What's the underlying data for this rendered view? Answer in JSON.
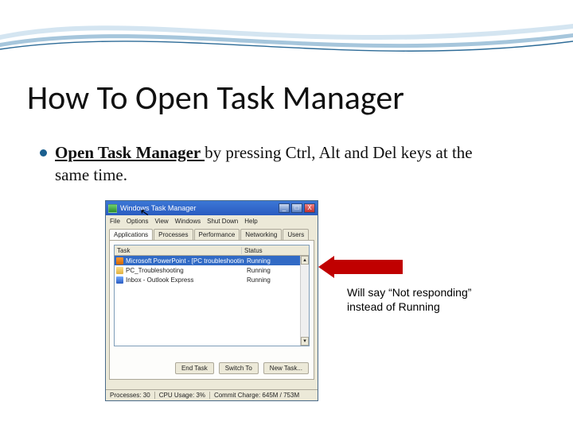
{
  "slide": {
    "title": "How To Open Task Manager",
    "bullet_bold": "Open Task Manager ",
    "bullet_rest": "by pressing Ctrl, Alt and Del keys at the same time."
  },
  "callout": {
    "text": "Will say “Not responding” instead of Running"
  },
  "tm": {
    "title": "Windows Task Manager",
    "menu": {
      "file": "File",
      "options": "Options",
      "view": "View",
      "windows": "Windows",
      "shutdown": "Shut Down",
      "help": "Help"
    },
    "tabs": {
      "applications": "Applications",
      "processes": "Processes",
      "performance": "Performance",
      "networking": "Networking",
      "users": "Users"
    },
    "cols": {
      "task": "Task",
      "status": "Status"
    },
    "rows": [
      {
        "name": "Microsoft PowerPoint - [PC troubleshooting p...",
        "status": "Running"
      },
      {
        "name": "PC_Troubleshooting",
        "status": "Running"
      },
      {
        "name": "Inbox - Outlook Express",
        "status": "Running"
      }
    ],
    "buttons": {
      "end_task": "End Task",
      "switch_to": "Switch To",
      "new_task": "New Task..."
    },
    "status": {
      "processes": "Processes: 30",
      "cpu": "CPU Usage: 3%",
      "commit": "Commit Charge: 645M / 753M"
    },
    "winbtn": {
      "min": "_",
      "max": "□",
      "close": "X"
    },
    "scroll": {
      "up": "▴",
      "down": "▾"
    }
  }
}
